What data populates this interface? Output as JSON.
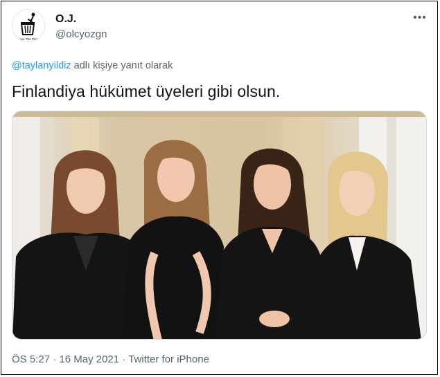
{
  "author": {
    "name": "O.J.",
    "handle": "@olcyozgn",
    "avatar_text": "Save The Planet"
  },
  "menu": {
    "more_icon": "more-horizontal-icon",
    "more_label": "•••"
  },
  "reply_context": {
    "mention": "@taylanyildiz",
    "suffix": " adlı kişiye yanıt olarak"
  },
  "tweet": {
    "text": "Finlandiya hükümet üyeleri gibi olsun."
  },
  "media": {
    "type": "photo",
    "people_count": 4
  },
  "meta": {
    "time": "ÖS 5:27",
    "sep1": " · ",
    "date": "16 May 2021",
    "sep2": " · ",
    "source": "Twitter for iPhone"
  },
  "colors": {
    "accent": "#1d9bf0",
    "text": "#0f1419",
    "muted": "#536471"
  }
}
